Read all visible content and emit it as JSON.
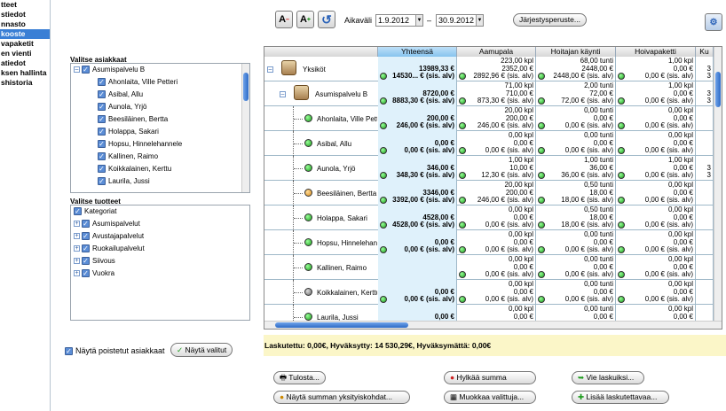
{
  "nav": {
    "items": [
      "tteet",
      "stiedot",
      "nnasto",
      "kooste",
      "vapaketit",
      "en vienti",
      "atiedot",
      "ksen hallinta",
      "shistoria"
    ],
    "active_index": 3
  },
  "toolbar": {
    "font_decrease": "A",
    "font_increase": "A",
    "refresh": "↺",
    "period_label": "Aikaväli",
    "date_start": "1.9.2012",
    "date_end": "30.9.2012",
    "separator": "–",
    "sort_button": "Järjestysperuste..."
  },
  "customers": {
    "title": "Valitse asiakkaat",
    "group": "Asumispalvelu B",
    "items": [
      "Ahonlaita, Ville Petteri",
      "Asibal, Allu",
      "Aunola, Yrjö",
      "Beesiläinen, Bertta",
      "Holappa, Sakari",
      "Hopsu, Hinnelehannele",
      "Kallinen, Raimo",
      "Koikkalainen, Kerttu",
      "Laurila, Jussi"
    ]
  },
  "products": {
    "title": "Valitse tuotteet",
    "root": "Kategoriat",
    "items": [
      "Asumispalvelut",
      "Avustajapalvelut",
      "Ruokailupalvelut",
      "Siivous",
      "Vuokra"
    ]
  },
  "show_deleted": {
    "label": "Näytä poistetut asiakkaat",
    "button": "Näytä valitut"
  },
  "grid": {
    "headers": [
      "",
      "Yhteensä",
      "Aamupala",
      "Hoitajan käynti",
      "Hoivapaketti",
      "Ku"
    ],
    "rows": [
      {
        "name": "Yksiköt",
        "type": "unit",
        "dot": "",
        "total": [
          "13989,33 €",
          "14530... € (sis. alv)"
        ],
        "aam": [
          "223,00 kpl",
          "2352,00 €",
          "2892,96 € (sis. alv)"
        ],
        "hoi": [
          "68,00 tunti",
          "2448,00 €",
          "2448,00 € (sis. alv)"
        ],
        "pak": [
          "1,00 kpl",
          "0,00 €",
          "0,00 € (sis. alv)"
        ],
        "ku": [
          "",
          "3",
          "3"
        ]
      },
      {
        "name": "Asumispalvelu B",
        "type": "unit",
        "dot": "",
        "total": [
          "8720,00 €",
          "8883,30 € (sis. alv)"
        ],
        "aam": [
          "71,00 kpl",
          "710,00 €",
          "873,30 € (sis. alv)"
        ],
        "hoi": [
          "2,00 tunti",
          "72,00 €",
          "72,00 € (sis. alv)"
        ],
        "pak": [
          "1,00 kpl",
          "0,00 €",
          "0,00 € (sis. alv)"
        ],
        "ku": [
          "",
          "3",
          "3"
        ]
      },
      {
        "name": "Ahonlaita, Ville Petteri",
        "type": "person",
        "dot": "g",
        "total": [
          "200,00 €",
          "246,00 € (sis. alv)"
        ],
        "aam": [
          "20,00 kpl",
          "200,00 €",
          "246,00 € (sis. alv)"
        ],
        "hoi": [
          "0,00 tunti",
          "0,00 €",
          "0,00 € (sis. alv)"
        ],
        "pak": [
          "0,00 kpl",
          "0,00 €",
          "0,00 € (sis. alv)"
        ],
        "ku": [
          "",
          "",
          ""
        ]
      },
      {
        "name": "Asibal, Allu",
        "type": "person",
        "dot": "g",
        "total": [
          "0,00 €",
          "0,00 € (sis. alv)"
        ],
        "aam": [
          "0,00 kpl",
          "0,00 €",
          "0,00 € (sis. alv)"
        ],
        "hoi": [
          "0,00 tunti",
          "0,00 €",
          "0,00 € (sis. alv)"
        ],
        "pak": [
          "0,00 kpl",
          "0,00 €",
          "0,00 € (sis. alv)"
        ],
        "ku": [
          "",
          "",
          ""
        ]
      },
      {
        "name": "Aunola, Yrjö",
        "type": "person",
        "dot": "g",
        "total": [
          "346,00 €",
          "348,30 € (sis. alv)"
        ],
        "aam": [
          "1,00 kpl",
          "10,00 €",
          "12,30 € (sis. alv)"
        ],
        "hoi": [
          "1,00 tunti",
          "36,00 €",
          "36,00 € (sis. alv)"
        ],
        "pak": [
          "1,00 kpl",
          "0,00 €",
          "0,00 € (sis. alv)"
        ],
        "ku": [
          "",
          "3",
          "3"
        ]
      },
      {
        "name": "Beesiläinen, Bertta",
        "type": "person",
        "dot": "o",
        "total": [
          "3346,00 €",
          "3392,00 € (sis. alv)"
        ],
        "aam": [
          "20,00 kpl",
          "200,00 €",
          "246,00 € (sis. alv)"
        ],
        "hoi": [
          "0,50 tunti",
          "18,00 €",
          "18,00 € (sis. alv)"
        ],
        "pak": [
          "0,00 kpl",
          "0,00 €",
          "0,00 € (sis. alv)"
        ],
        "ku": [
          "",
          "",
          ""
        ]
      },
      {
        "name": "Holappa, Sakari",
        "type": "person",
        "dot": "g",
        "total": [
          "4528,00 €",
          "4528,00 € (sis. alv)"
        ],
        "aam": [
          "0,00 kpl",
          "0,00 €",
          "0,00 € (sis. alv)"
        ],
        "hoi": [
          "0,50 tunti",
          "18,00 €",
          "18,00 € (sis. alv)"
        ],
        "pak": [
          "0,00 kpl",
          "0,00 €",
          "0,00 € (sis. alv)"
        ],
        "ku": [
          "",
          "",
          ""
        ]
      },
      {
        "name": "Hopsu, Hinnelehannele",
        "type": "person",
        "dot": "g",
        "total": [
          "0,00 €",
          "0,00 € (sis. alv)"
        ],
        "aam": [
          "0,00 kpl",
          "0,00 €",
          "0,00 € (sis. alv)"
        ],
        "hoi": [
          "0,00 tunti",
          "0,00 €",
          "0,00 € (sis. alv)"
        ],
        "pak": [
          "0,00 kpl",
          "0,00 €",
          "0,00 € (sis. alv)"
        ],
        "ku": [
          "",
          "",
          ""
        ]
      },
      {
        "name": "Kallinen, Raimo",
        "type": "person",
        "dot": "g",
        "total": [
          "",
          ""
        ],
        "aam": [
          "0,00 kpl",
          "0,00 €",
          "0,00 € (sis. alv)"
        ],
        "hoi": [
          "0,00 tunti",
          "0,00 €",
          "0,00 € (sis. alv)"
        ],
        "pak": [
          "0,00 kpl",
          "0,00 €",
          "0,00 € (sis. alv)"
        ],
        "ku": [
          "",
          "",
          ""
        ]
      },
      {
        "name": "Koikkalainen, Kerttu",
        "type": "person",
        "dot": "gr",
        "total": [
          "0,00 €",
          "0,00 € (sis. alv)"
        ],
        "aam": [
          "0,00 kpl",
          "0,00 €",
          "0,00 € (sis. alv)"
        ],
        "hoi": [
          "0,00 tunti",
          "0,00 €",
          "0,00 € (sis. alv)"
        ],
        "pak": [
          "0,00 kpl",
          "0,00 €",
          "0,00 € (sis. alv)"
        ],
        "ku": [
          "",
          "",
          ""
        ]
      },
      {
        "name": "Laurila, Jussi",
        "type": "person",
        "dot": "g",
        "total": [
          "0,00 €",
          ""
        ],
        "aam": [
          "0,00 kpl",
          "0,00 €",
          ""
        ],
        "hoi": [
          "0,00 tunti",
          "0,00 €",
          ""
        ],
        "pak": [
          "0,00 kpl",
          "0,00 €",
          ""
        ],
        "ku": [
          "",
          "",
          ""
        ]
      }
    ]
  },
  "summary": "Laskutettu: 0,00€, Hyväksytty: 14 530,29€, Hyväksymättä: 0,00€",
  "buttons": {
    "print": "Tulosta...",
    "reject": "Hylkää summa",
    "export": "Vie laskuiksi...",
    "details": "Näytä summan yksityiskohdat...",
    "edit": "Muokkaa valittuja...",
    "add": "Lisää laskutettavaa..."
  },
  "colors": {
    "accent": "#3a7fd5",
    "summary_bg": "#fbf6c8",
    "total_col": "#dff1fb"
  }
}
